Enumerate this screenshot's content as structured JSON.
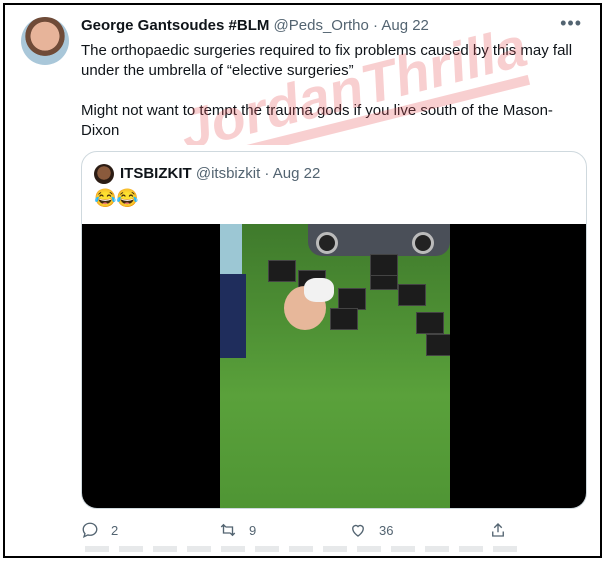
{
  "tweet": {
    "author_name": "George Gantsoudes #BLM",
    "handle": "@Peds_Ortho",
    "separator": "·",
    "date": "Aug 22",
    "paragraph1": "The orthopaedic surgeries required to fix problems caused by this may fall under the umbrella of “elective surgeries”",
    "paragraph2": "Might not want to tempt the trauma gods if you live south of the Mason-Dixon",
    "more_icon": "more-horizontal-icon"
  },
  "watermark": {
    "text": "JordanThrilla",
    "color": "#e8565a"
  },
  "quoted": {
    "author_name": "ITSBIZKIT",
    "handle": "@itsbizkit",
    "separator": "·",
    "date": "Aug 22",
    "emoji": "😂😂"
  },
  "actions": {
    "reply_count": "2",
    "retweet_count": "9",
    "like_count": "36",
    "icons": [
      "reply-icon",
      "retweet-icon",
      "like-icon",
      "share-icon"
    ]
  }
}
